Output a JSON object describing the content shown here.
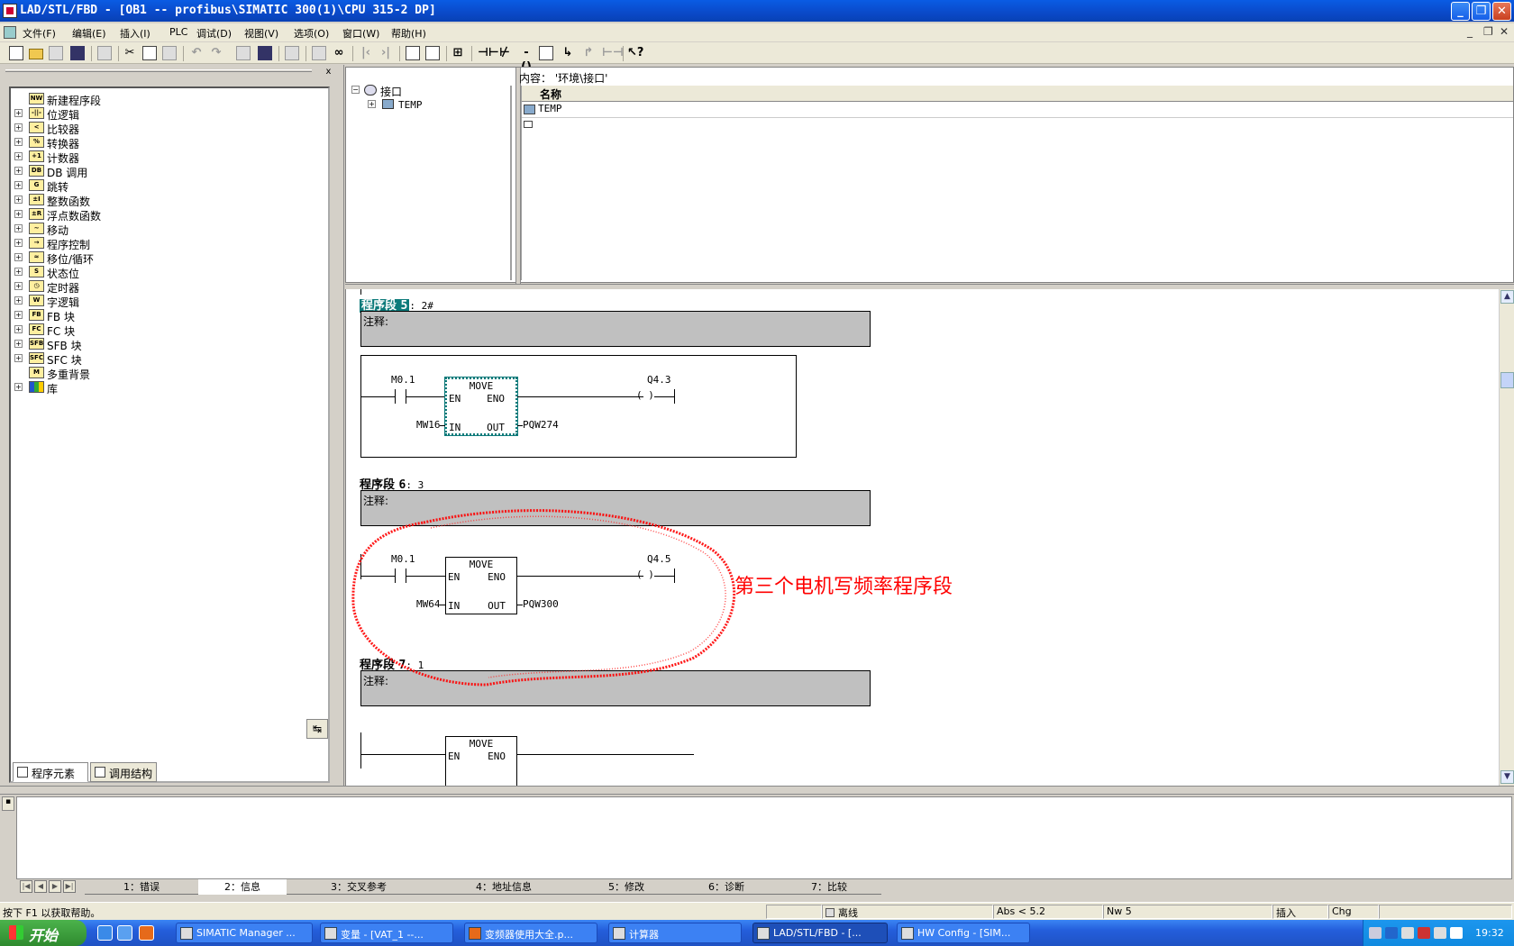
{
  "window": {
    "title": "LAD/STL/FBD  - [OB1 -- profibus\\SIMATIC 300(1)\\CPU 315-2 DP]",
    "buttons": {
      "minimize": "_",
      "restore": "❐",
      "close": "✕"
    }
  },
  "menu": {
    "items": [
      "文件(F)",
      "编辑(E)",
      "插入(I)",
      "PLC",
      "调试(D)",
      "视图(V)",
      "选项(O)",
      "窗口(W)",
      "帮助(H)"
    ],
    "mdi_buttons": [
      "_",
      "❐",
      "✕"
    ]
  },
  "toolbar": {
    "icons": [
      "new-icon",
      "open-icon",
      "accessible-nodes-icon",
      "save-icon",
      "print-icon",
      "cut-icon",
      "copy-icon",
      "paste-icon",
      "undo-icon",
      "redo-icon",
      "download-icon",
      "monitor-icon",
      "overview-icon",
      "network-icon",
      "glasses-icon",
      "prev-icon",
      "next-icon",
      "split-icon",
      "view-icon",
      "new-network-icon",
      "contact-no-icon",
      "contact-nc-icon",
      "coil-icon",
      "box-icon",
      "branch-open-icon",
      "branch-close-icon",
      "connection-icon",
      "help-icon"
    ]
  },
  "left_panel": {
    "close": "x",
    "tree": [
      {
        "label": "新建程序段",
        "expandable": false,
        "icon": "new-network-icon",
        "abbr": "NW"
      },
      {
        "label": "位逻辑",
        "expandable": true,
        "icon": "bit-logic-icon",
        "abbr": "-||-"
      },
      {
        "label": "比较器",
        "expandable": true,
        "icon": "comparator-icon",
        "abbr": "<"
      },
      {
        "label": "转换器",
        "expandable": true,
        "icon": "converter-icon",
        "abbr": "%"
      },
      {
        "label": "计数器",
        "expandable": true,
        "icon": "counter-icon",
        "abbr": "+1"
      },
      {
        "label": "DB 调用",
        "expandable": true,
        "icon": "db-call-icon",
        "abbr": "DB"
      },
      {
        "label": "跳转",
        "expandable": true,
        "icon": "jump-icon",
        "abbr": "G"
      },
      {
        "label": "整数函数",
        "expandable": true,
        "icon": "integer-icon",
        "abbr": "±I"
      },
      {
        "label": "浮点数函数",
        "expandable": true,
        "icon": "float-icon",
        "abbr": "±R"
      },
      {
        "label": "移动",
        "expandable": true,
        "icon": "move-icon",
        "abbr": "~"
      },
      {
        "label": "程序控制",
        "expandable": true,
        "icon": "program-control-icon",
        "abbr": "→"
      },
      {
        "label": "移位/循环",
        "expandable": true,
        "icon": "shift-icon",
        "abbr": "≈"
      },
      {
        "label": "状态位",
        "expandable": true,
        "icon": "status-bit-icon",
        "abbr": "S"
      },
      {
        "label": "定时器",
        "expandable": true,
        "icon": "timer-icon",
        "abbr": "◷"
      },
      {
        "label": "字逻辑",
        "expandable": true,
        "icon": "word-logic-icon",
        "abbr": "W"
      },
      {
        "label": "FB 块",
        "expandable": true,
        "icon": "fb-block-icon",
        "abbr": "FB"
      },
      {
        "label": "FC 块",
        "expandable": true,
        "icon": "fc-block-icon",
        "abbr": "FC"
      },
      {
        "label": "SFB 块",
        "expandable": true,
        "icon": "sfb-block-icon",
        "abbr": "SFB"
      },
      {
        "label": "SFC 块",
        "expandable": true,
        "icon": "sfc-block-icon",
        "abbr": "SFC"
      },
      {
        "label": "多重背景",
        "expandable": false,
        "icon": "multi-instance-icon",
        "abbr": "M"
      },
      {
        "label": "库",
        "expandable": true,
        "icon": "library-icon",
        "abbr": ""
      }
    ],
    "sort_button": "↹",
    "tabs": [
      {
        "label": "程序元素",
        "active": true
      },
      {
        "label": "调用结构",
        "active": false
      }
    ]
  },
  "interface": {
    "content_label": "内容：  '环境\\接口'",
    "tree_root": "接口",
    "tree_child": "TEMP",
    "column_name": "名称",
    "rows": [
      "TEMP",
      ""
    ]
  },
  "editor": {
    "networks": [
      {
        "label": "程序段",
        "number": "5",
        "title": ": 2#",
        "highlight": true,
        "comment": "注释:",
        "contact": "M0.1",
        "box": "MOVE",
        "en": "EN",
        "eno": "ENO",
        "in_pin": "IN",
        "out_pin": "OUT",
        "in_operand": "MW16",
        "out_operand": "PQW274",
        "coil": "Q4.3",
        "selected": true
      },
      {
        "label": "程序段",
        "number": "6",
        "title": ": 3",
        "highlight": false,
        "comment": "注释:",
        "contact": "M0.1",
        "box": "MOVE",
        "en": "EN",
        "eno": "ENO",
        "in_pin": "IN",
        "out_pin": "OUT",
        "in_operand": "MW64",
        "out_operand": "PQW300",
        "coil": "Q4.5",
        "selected": false
      },
      {
        "label": "程序段",
        "number": "7",
        "title": ": 1",
        "highlight": false,
        "comment": "注释:",
        "box": "MOVE",
        "en": "EN",
        "eno": "ENO"
      }
    ],
    "coil_symbol": "( )",
    "annotation": "第三个电机写频率程序段",
    "annotation_color": "#ff0000",
    "scroll": {
      "up": "▲",
      "down": "▼"
    }
  },
  "output": {
    "nav": [
      "|◀",
      "◀",
      "▶",
      "▶|"
    ],
    "tabs": [
      {
        "label": "1：错误",
        "active": false
      },
      {
        "label": "2：信息",
        "active": true
      },
      {
        "label": "3：交叉参考",
        "active": false
      },
      {
        "label": "4：地址信息",
        "active": false
      },
      {
        "label": "5：修改",
        "active": false
      },
      {
        "label": "6：诊断",
        "active": false
      },
      {
        "label": "7：比较",
        "active": false
      }
    ]
  },
  "status": {
    "help": "按下 F1 以获取帮助。",
    "mode": "离线",
    "abs": "Abs < 5.2",
    "nw": "Nw 5",
    "insert": "插入",
    "chg": "Chg"
  },
  "taskbar": {
    "start": "开始",
    "tasks": [
      {
        "label": "SIMATIC Manager ...",
        "active": false
      },
      {
        "label": "变量 - [VAT_1 --...",
        "active": false
      },
      {
        "label": "变频器使用大全.p...",
        "active": false
      },
      {
        "label": "计算器",
        "active": false
      },
      {
        "label": "LAD/STL/FBD  - [...",
        "active": true
      },
      {
        "label": "HW Config - [SIM...",
        "active": false
      }
    ],
    "clock": "19:32"
  }
}
